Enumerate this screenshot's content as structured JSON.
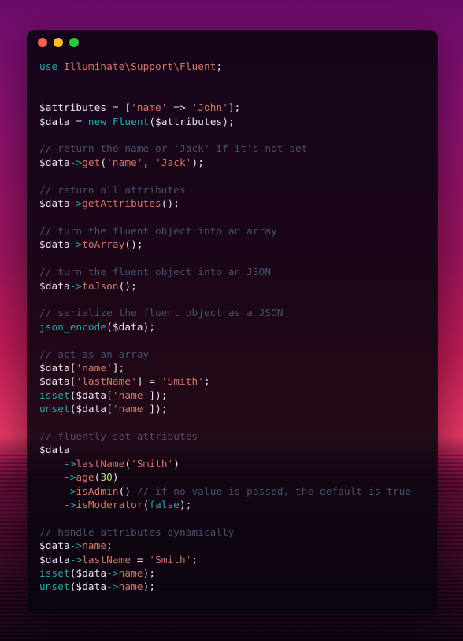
{
  "code": {
    "l1_use": "use",
    "l1_ns": "Illuminate\\Support\\Fluent",
    "l3_var_attr": "$attributes",
    "l3_eq": " = ",
    "l3_br_open": "[",
    "l3_key": "'name'",
    "l3_fat": " => ",
    "l3_val": "'John'",
    "l3_br_close": "];",
    "l4_var_data": "$data",
    "l4_eq": " = ",
    "l4_new": "new",
    "l4_cls": "Fluent",
    "l4_open": "(",
    "l4_arg": "$attributes",
    "l4_close": ");",
    "c1": "// return the name or 'Jack' if it's not set",
    "l6_data": "$data",
    "l6_arrow": "->",
    "l6_fn": "get",
    "l6_open": "(",
    "l6_arg1": "'name'",
    "l6_comma": ", ",
    "l6_arg2": "'Jack'",
    "l6_close": ");",
    "c2": "// return all attributes",
    "l8_data": "$data",
    "l8_arrow": "->",
    "l8_fn": "getAttributes",
    "l8_paren": "();",
    "c3": "// turn the fluent object into an array",
    "l10_data": "$data",
    "l10_arrow": "->",
    "l10_fn": "toArray",
    "l10_paren": "();",
    "c4": "// turn the fluent object into an JSON",
    "l12_data": "$data",
    "l12_arrow": "->",
    "l12_fn": "toJson",
    "l12_paren": "();",
    "c5": "// serialize the fluent object as a JSON",
    "l14_fn": "json_encode",
    "l14_open": "(",
    "l14_arg": "$data",
    "l14_close": ");",
    "c6": "// act as an array",
    "l16_data": "$data",
    "l16_br": "[",
    "l16_key": "'name'",
    "l16_close": "];",
    "l17_data": "$data",
    "l17_br": "[",
    "l17_key": "'lastName'",
    "l17_mid": "] = ",
    "l17_val": "'Smith'",
    "l17_close": ";",
    "l18_isset": "isset",
    "l18_open": "(",
    "l18_data": "$data",
    "l18_br": "[",
    "l18_key": "'name'",
    "l18_close": "]);",
    "l19_unset": "unset",
    "l19_open": "(",
    "l19_data": "$data",
    "l19_br": "[",
    "l19_key": "'name'",
    "l19_close": "]);",
    "c7": "// fluently set attributes",
    "l21_data": "$data",
    "l22_pad": "    ",
    "l22_arrow": "->",
    "l22_fn": "lastName",
    "l22_open": "(",
    "l22_arg": "'Smith'",
    "l22_close": ")",
    "l23_pad": "    ",
    "l23_arrow": "->",
    "l23_fn": "age",
    "l23_open": "(",
    "l23_arg": "30",
    "l23_close": ")",
    "l24_pad": "    ",
    "l24_arrow": "->",
    "l24_fn": "isAdmin",
    "l24_paren": "() ",
    "l24_cmt": "// if no value is passed, the default is true",
    "l25_pad": "    ",
    "l25_arrow": "->",
    "l25_fn": "isModerator",
    "l25_open": "(",
    "l25_arg": "false",
    "l25_close": ");",
    "c8": "// handle attributes dynamically",
    "l27_data": "$data",
    "l27_arrow": "->",
    "l27_prop": "name",
    "l27_close": ";",
    "l28_data": "$data",
    "l28_arrow": "->",
    "l28_prop": "lastName",
    "l28_eq": " = ",
    "l28_val": "'Smith'",
    "l28_close": ";",
    "l29_isset": "isset",
    "l29_open": "(",
    "l29_data": "$data",
    "l29_arrow": "->",
    "l29_prop": "name",
    "l29_close": ");",
    "l30_unset": "unset",
    "l30_open": "(",
    "l30_data": "$data",
    "l30_arrow": "->",
    "l30_prop": "name",
    "l30_close": ");"
  }
}
